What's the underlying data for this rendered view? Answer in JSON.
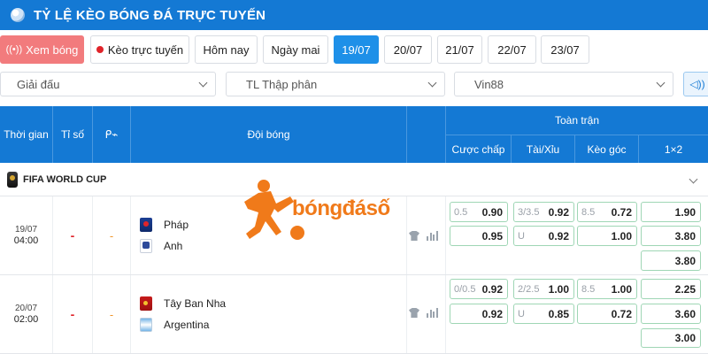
{
  "header": {
    "title": "TỶ LỆ KÈO BÓNG ĐÁ TRỰC TUYẾN",
    "icon": "globe-icon"
  },
  "tabs": [
    {
      "label": "Xem bóng",
      "state": "live-watch",
      "icon": "broadcast-icon"
    },
    {
      "label": "Kèo trực tuyến",
      "state": "default",
      "icon": "live-dot-icon"
    },
    {
      "label": "Hôm nay",
      "state": "default"
    },
    {
      "label": "Ngày mai",
      "state": "default"
    },
    {
      "label": "19/07",
      "state": "active"
    },
    {
      "label": "20/07",
      "state": "default"
    },
    {
      "label": "21/07",
      "state": "default"
    },
    {
      "label": "22/07",
      "state": "default"
    },
    {
      "label": "23/07",
      "state": "default"
    }
  ],
  "filters": {
    "league": "Giải đấu",
    "odds_format": "TL Thập phân",
    "bookmaker": "Vin88"
  },
  "table_header": {
    "time": "Thời gian",
    "score": "Tỉ số",
    "teams": "Đội bóng",
    "full_match": "Toàn trận",
    "handicap": "Cược chấp",
    "over_under": "Tài/Xỉu",
    "corners": "Kèo góc",
    "one_x_two": "1×2"
  },
  "league": {
    "name": "FIFA WORLD CUP"
  },
  "matches": [
    {
      "date": "19/07",
      "hour": "04:00",
      "score": "-",
      "minute": "-",
      "home": "Pháp",
      "away": "Anh",
      "handicap": {
        "line": "0.5",
        "home": "0.90",
        "away": "0.95"
      },
      "over_under": {
        "line": "3/3.5",
        "over": "0.92",
        "under_label": "U",
        "under": "0.92"
      },
      "corners": {
        "line": "8.5",
        "over": "0.72",
        "under": "1.00"
      },
      "one_x_two": {
        "home": "1.90",
        "draw": "3.80",
        "away": "3.80"
      }
    },
    {
      "date": "20/07",
      "hour": "02:00",
      "score": "-",
      "minute": "-",
      "home": "Tây Ban Nha",
      "away": "Argentina",
      "handicap": {
        "line": "0/0.5",
        "home": "0.92",
        "away": "0.92"
      },
      "over_under": {
        "line": "2/2.5",
        "over": "1.00",
        "under_label": "U",
        "under": "0.85"
      },
      "corners": {
        "line": "8.5",
        "over": "1.00",
        "under": "0.72"
      },
      "one_x_two": {
        "home": "2.25",
        "draw": "3.60",
        "away": "3.00"
      }
    }
  ],
  "watermark": {
    "text": "bóngđásố"
  },
  "colors": {
    "brand_blue": "#1479d4",
    "active_tab": "#1e90e8",
    "live_tab": "#f27b7d",
    "odds_border": "#9fd6b5",
    "logo_orange": "#f07a1a"
  }
}
